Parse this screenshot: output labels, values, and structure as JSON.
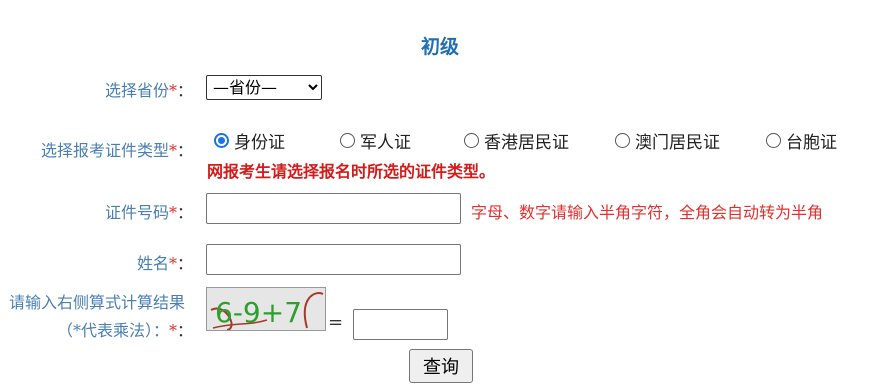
{
  "title": "初级",
  "required_mark": "*",
  "colon": "：",
  "province": {
    "label": "选择省份",
    "selected": "—省份—"
  },
  "id_type": {
    "label": "选择报考证件类型",
    "options": [
      "身份证",
      "军人证",
      "香港居民证",
      "澳门居民证",
      "台胞证"
    ],
    "selected_index": 0,
    "warning": "网报考生请选择报名时所选的证件类型。"
  },
  "id_number": {
    "label": "证件号码",
    "value": "",
    "hint": "字母、数字请输入半角字符，全角会自动转为半角"
  },
  "name": {
    "label": "姓名",
    "value": ""
  },
  "captcha": {
    "label_line1": "请输入右侧算式计算结果",
    "label_line2": "（*代表乘法）：",
    "expression": "6-9+7",
    "equals": "=",
    "answer": ""
  },
  "submit_label": "查询",
  "colors": {
    "title": "#1f6fb2",
    "label": "#4a7fb3",
    "required": "#e0312d",
    "warning": "#d41a1a",
    "captcha_text": "#2e9e2e"
  }
}
